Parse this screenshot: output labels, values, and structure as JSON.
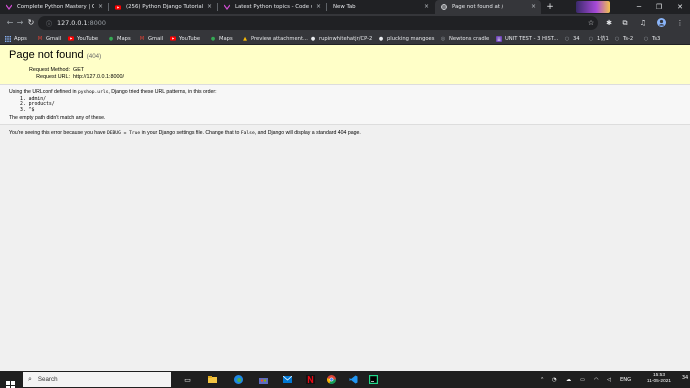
{
  "browser": {
    "tabs": [
      {
        "title": "Complete Python Mastery | Code",
        "icon": "code-logo-icon",
        "active": false
      },
      {
        "title": "(256) Python Django Tutorial 202",
        "icon": "youtube-icon",
        "active": false
      },
      {
        "title": "Latest Python topics - Code with",
        "icon": "code-logo-icon",
        "active": false
      },
      {
        "title": "New Tab",
        "icon": "",
        "active": false
      },
      {
        "title": "Page not found at /",
        "icon": "globe-icon",
        "active": true
      }
    ],
    "new_tab_label": "+",
    "address": {
      "host": "127.0.0.1",
      "port": ":8000"
    },
    "bookmarks": [
      {
        "label": "Apps",
        "icon": "apps-grid-icon"
      },
      {
        "label": "Gmail",
        "icon": "gmail-icon"
      },
      {
        "label": "YouTube",
        "icon": "youtube-icon"
      },
      {
        "label": "Maps",
        "icon": "maps-icon"
      },
      {
        "label": "Gmail",
        "icon": "gmail-icon"
      },
      {
        "label": "YouTube",
        "icon": "youtube-icon"
      },
      {
        "label": "Maps",
        "icon": "maps-icon"
      },
      {
        "label": "Preview attachment...",
        "icon": "drive-icon"
      },
      {
        "label": "rupinwhitehatjr/CP-2",
        "icon": "github-icon"
      },
      {
        "label": "plucking mangoes",
        "icon": "github-icon"
      },
      {
        "label": "Newtons cradle",
        "icon": "globe-icon"
      },
      {
        "label": "UNIT TEST - 3 HIST...",
        "icon": "forms-icon"
      },
      {
        "label": "34",
        "icon": "github-icon"
      },
      {
        "label": "1仿1",
        "icon": "github-icon"
      },
      {
        "label": "Ts-2",
        "icon": "github-icon"
      },
      {
        "label": "Ts3",
        "icon": "github-icon"
      }
    ]
  },
  "page": {
    "title": "Page not found",
    "status_code": "(404)",
    "request_method_label": "Request Method:",
    "request_method": "GET",
    "request_url_label": "Request URL:",
    "request_url": "http://127.0.0.1:8000/",
    "urlconf_prefix": "Using the URLconf defined in",
    "urlconf_module": "pyshop.urls",
    "urlconf_suffix": ", Django tried these URL patterns, in this order:",
    "patterns": [
      "1. admin/",
      "2. products/",
      "3. ^$"
    ],
    "empty_path_msg": "The empty path didn't match any of these.",
    "explain_1": "You're seeing this error because you have",
    "explain_code_1": "DEBUG = True",
    "explain_2": "in your Django settings file. Change that to",
    "explain_code_2": "False",
    "explain_3": ", and Django will display a standard 404 page."
  },
  "taskbar": {
    "search_placeholder": "Search",
    "language": "ENG",
    "time": "15:53",
    "date": "11-05-2021",
    "notification_count": "34"
  }
}
